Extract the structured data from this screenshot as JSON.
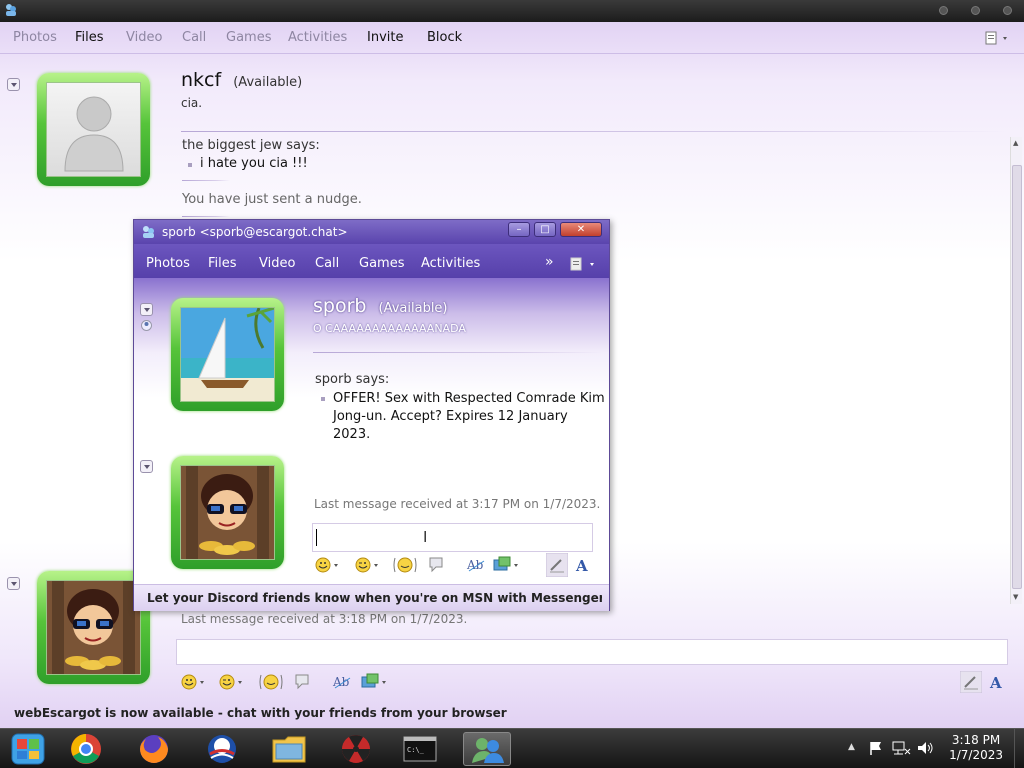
{
  "window": {
    "menu": [
      "Photos",
      "Files",
      "Video",
      "Call",
      "Games",
      "Activities",
      "Invite",
      "Block"
    ]
  },
  "contact": {
    "name": "nkcf",
    "status": "(Available)",
    "personal_message": "cia."
  },
  "conversation": {
    "sender_line": "the biggest jew says:",
    "message": "i hate you cia !!!",
    "nudge_notice": "You have just sent a nudge.",
    "last_received": "Last message received at 3:18 PM on 1/7/2023."
  },
  "footer_notice": "webEscargot is now available - chat with your friends from your browser",
  "popup": {
    "title": "sporb <sporb@escargot.chat>",
    "menu": [
      "Photos",
      "Files",
      "Video",
      "Call",
      "Games",
      "Activities"
    ],
    "contact_name": "sporb",
    "contact_status": "(Available)",
    "personal_message": "O CAAAAAAAAAAAAANADA",
    "sender_line": "sporb says:",
    "message": "OFFER! Sex with Respected Comrade Kim Jong-un. Accept? Expires 12 January 2023.",
    "last_received": "Last message received at 3:17 PM on 1/7/2023.",
    "footer_notice": "Let your Discord friends know when you're on MSN with Messenger Rich P..."
  },
  "taskbar": {
    "apps": [
      "media-center",
      "chrome",
      "firefox",
      "obama",
      "file-explorer",
      "radiation",
      "cmd",
      "messenger"
    ],
    "active_app": "messenger",
    "time": "3:18 PM",
    "date": "1/7/2023"
  },
  "colors": {
    "accent_purple": "#5a44ad",
    "frame_green": "#56c43a",
    "taskbar_dark": "#1f1f1f"
  }
}
